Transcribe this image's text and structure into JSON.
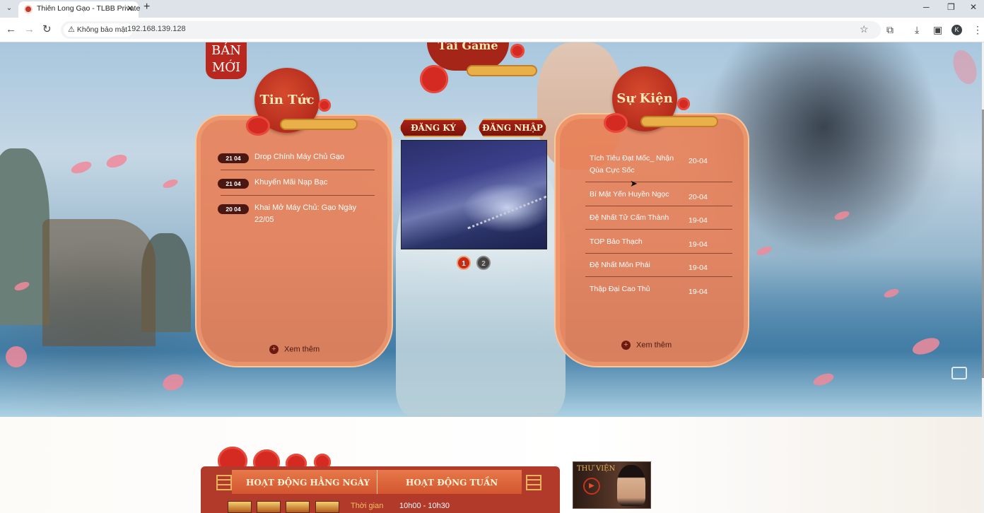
{
  "browser": {
    "tab_title": "Thiên Long Gạo - TLBB Private",
    "security_label": "Không bảo mật",
    "url": "192.168.139.128",
    "profile_initial": "K"
  },
  "banner": {
    "ban_moi": [
      "BẢN",
      "MỚI"
    ],
    "tai_game": "Tải Game"
  },
  "news": {
    "heading": "Tin Tức",
    "items": [
      {
        "date": "21 04",
        "title": "Drop Chính Máy Chủ Gạo"
      },
      {
        "date": "21 04",
        "title": "Khuyến Mãi Nạp Bạc"
      },
      {
        "date": "20 04",
        "title": "Khai Mở Máy Chủ: Gạo Ngày 22/05"
      }
    ],
    "more_label": "Xem thêm"
  },
  "auth": {
    "register_label": "ĐĂNG KÝ",
    "login_label": "ĐĂNG NHẬP"
  },
  "slider": {
    "pages": [
      "1",
      "2"
    ],
    "active_page": 1
  },
  "events": {
    "heading": "Sự Kiện",
    "items": [
      {
        "title": "Tích Tiêu Đạt Mốc_ Nhận Qùa Cực Sốc",
        "date": "20-04"
      },
      {
        "title": "Bí Mật Yến Huyền Ngọc",
        "date": "20-04"
      },
      {
        "title": "Đệ Nhất Tử Cấm Thành",
        "date": "19-04"
      },
      {
        "title": "TOP Bảo Thạch",
        "date": "19-04"
      },
      {
        "title": "Đệ Nhất Môn Phái",
        "date": "19-04"
      },
      {
        "title": "Thập Đại Cao Thủ",
        "date": "19-04"
      }
    ],
    "more_label": "Xem thêm"
  },
  "activities": {
    "tabs": [
      "HOẠT ĐỘNG HẰNG NGÀY",
      "HOẠT ĐỘNG TUẦN"
    ],
    "time_label": "Thời gian",
    "time_value": "10h00 - 10h30"
  },
  "library": {
    "label": "THƯ VIỆN"
  }
}
